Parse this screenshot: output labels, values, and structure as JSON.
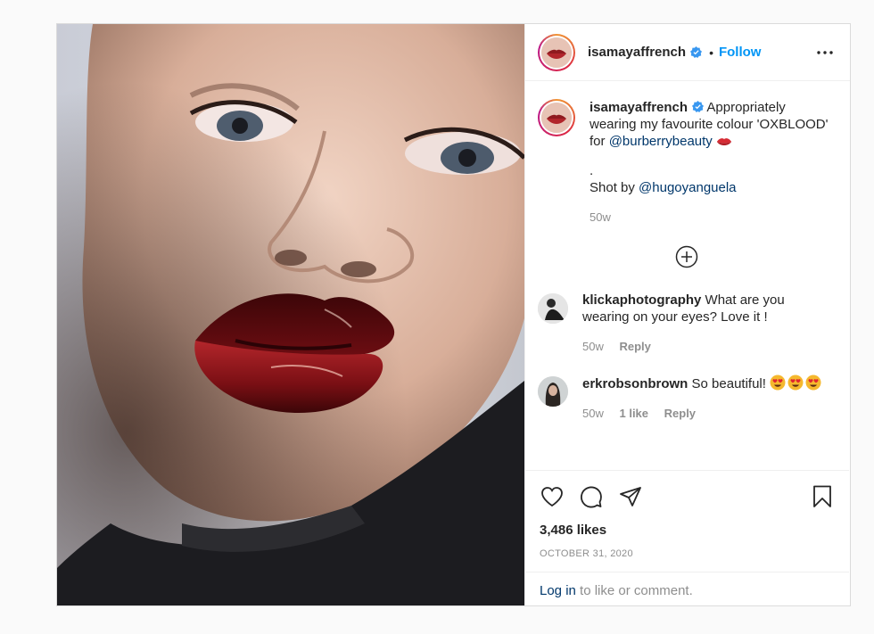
{
  "post": {
    "username": "isamayaffrench",
    "dot": "•",
    "follow_label": "Follow",
    "caption": {
      "text": "Appropriately wearing my favourite colour 'OXBLOOD' for",
      "mention": "@burberrybeauty",
      "emoji": "lips-emoji",
      "period": ".",
      "credit_prefix": "Shot by",
      "credit_mention": "@hugoyanguela",
      "age": "50w"
    },
    "comments": [
      {
        "username": "klickaphotography",
        "text": "What are you wearing on your eyes? Love it !",
        "age": "50w",
        "reply_label": "Reply"
      },
      {
        "username": "erkrobsonbrown",
        "text": "So beautiful!",
        "emoji": "heart-eyes-emoji",
        "age": "50w",
        "likes": "1 like",
        "reply_label": "Reply"
      }
    ],
    "likes": "3,486 likes",
    "date": "OCTOBER 31, 2020",
    "login_link": "Log in",
    "login_suffix": "to like or comment."
  },
  "colors": {
    "follow": "#0095f6",
    "link": "#00376b",
    "muted": "#8e8e8e",
    "verified": "#3897f0",
    "lip": "#7a0f14"
  },
  "icons": [
    "verified-badge-icon",
    "more-options-icon",
    "load-more-comments-icon",
    "heart-icon",
    "comment-icon",
    "share-icon",
    "bookmark-icon"
  ]
}
